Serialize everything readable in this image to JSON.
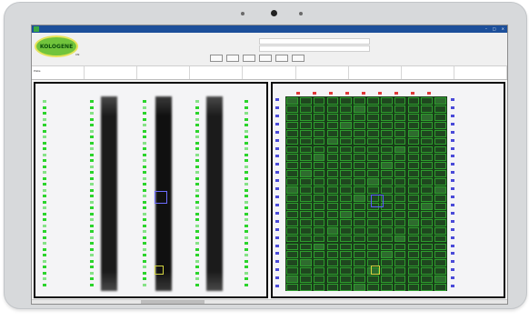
{
  "window": {
    "title_text": "",
    "controls": [
      "–",
      "□",
      "×"
    ]
  },
  "logo": {
    "label": "KOLOGENE",
    "tag": "CN"
  },
  "toolbar": {
    "buttons": [
      "",
      "",
      "",
      "",
      "",
      ""
    ]
  },
  "info": {
    "cols": [
      {
        "label": "Plate",
        "value": ""
      },
      {
        "label": "",
        "value": ""
      },
      {
        "label": "",
        "value": ""
      },
      {
        "label": "",
        "value": ""
      },
      {
        "label": "",
        "value": ""
      },
      {
        "label": "",
        "value": ""
      },
      {
        "label": "",
        "value": ""
      },
      {
        "label": "",
        "value": ""
      },
      {
        "label": "",
        "value": ""
      }
    ]
  },
  "left_panel": {
    "title": ""
  },
  "right_panel": {
    "title": ""
  },
  "colors": {
    "titlebar": "#1c4f9a",
    "grid_green": "#2bd42b",
    "panel_border": "#0a0a0a"
  }
}
